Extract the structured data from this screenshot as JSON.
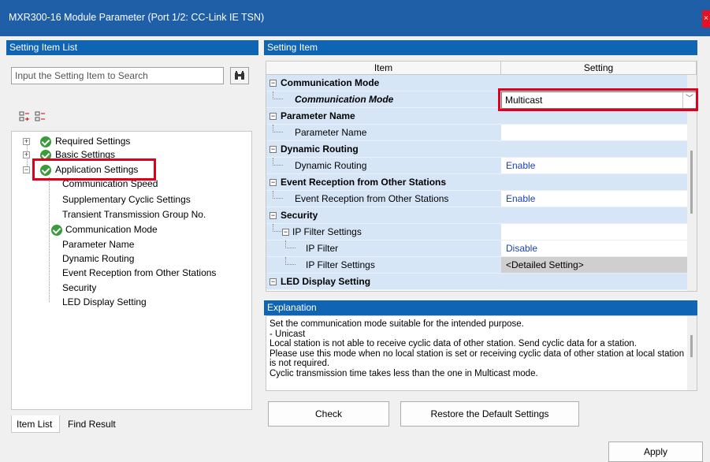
{
  "window": {
    "title": "MXR300-16 Module Parameter (Port 1/2: CC-Link IE TSN)"
  },
  "left": {
    "header": "Setting Item List",
    "search_placeholder": "Input the Setting Item to Search",
    "tree": [
      {
        "label": "Required Settings",
        "check": true,
        "expander": "+"
      },
      {
        "label": "Basic Settings",
        "check": true,
        "expander": "+"
      },
      {
        "label": "Application Settings",
        "check": true,
        "expander": "-"
      },
      {
        "label": "Communication Speed",
        "check": false
      },
      {
        "label": "Supplementary Cyclic Settings",
        "check": false
      },
      {
        "label": "Transient Transmission Group No.",
        "check": false
      },
      {
        "label": "Communication Mode",
        "check": true
      },
      {
        "label": "Parameter Name",
        "check": false
      },
      {
        "label": "Dynamic Routing",
        "check": false
      },
      {
        "label": "Event Reception from Other Stations",
        "check": false
      },
      {
        "label": "Security",
        "check": false
      },
      {
        "label": "LED Display Setting",
        "check": false
      }
    ],
    "tabs": [
      "Item List",
      "Find Result"
    ]
  },
  "right": {
    "header": "Setting Item",
    "columns": [
      "Item",
      "Setting"
    ],
    "rows": [
      {
        "label": "Communication Mode",
        "type": "cat",
        "setting": ""
      },
      {
        "label": "Communication Mode",
        "type": "item-bold",
        "setting": "Multicast"
      },
      {
        "label": "Parameter Name",
        "type": "cat",
        "setting": ""
      },
      {
        "label": "Parameter Name",
        "type": "item",
        "setting": ""
      },
      {
        "label": "Dynamic Routing",
        "type": "cat",
        "setting": ""
      },
      {
        "label": "Dynamic Routing",
        "type": "item",
        "setting": "Enable"
      },
      {
        "label": "Event Reception from Other Stations",
        "type": "cat",
        "setting": ""
      },
      {
        "label": "Event Reception from Other Stations",
        "type": "item",
        "setting": "Enable"
      },
      {
        "label": "Security",
        "type": "cat",
        "setting": ""
      },
      {
        "label": "IP Filter Settings",
        "type": "subcat",
        "setting": ""
      },
      {
        "label": "IP Filter",
        "type": "item2",
        "setting": "Disable"
      },
      {
        "label": "IP Filter Settings",
        "type": "item2",
        "setting": "<Detailed Setting>"
      },
      {
        "label": "LED Display Setting",
        "type": "cat",
        "setting": ""
      }
    ],
    "explanation_header": "Explanation",
    "explanation_text": "Set the communication mode suitable for the intended purpose.\n- Unicast\nLocal station is not able to receive cyclic data of other station. Send cyclic data for a station.\nPlease use this mode when no local station is set or receiving cyclic data of other station at local station is not required.\nCyclic transmission time takes less than the one in Multicast mode."
  },
  "buttons": {
    "check": "Check",
    "check_key": "k",
    "restore": "Restore the Default Settings",
    "restore_key": "u",
    "apply": "Apply",
    "apply_key": "A"
  },
  "colors": {
    "title_bar": "#1e5fa8",
    "panel_header": "#0f64b4",
    "row_bg": "#d6e6f7",
    "highlight": "#e0001b",
    "setting_text": "#1a3fc1"
  }
}
